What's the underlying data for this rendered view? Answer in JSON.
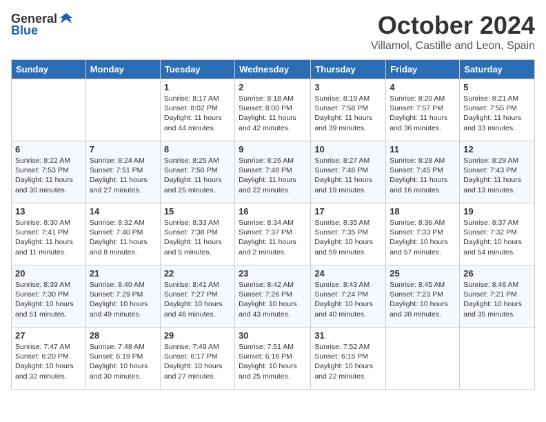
{
  "header": {
    "logo_general": "General",
    "logo_blue": "Blue",
    "month": "October 2024",
    "location": "Villamol, Castille and Leon, Spain"
  },
  "days_of_week": [
    "Sunday",
    "Monday",
    "Tuesday",
    "Wednesday",
    "Thursday",
    "Friday",
    "Saturday"
  ],
  "weeks": [
    [
      {
        "day": null,
        "data": null
      },
      {
        "day": null,
        "data": null
      },
      {
        "day": 1,
        "data": {
          "sunrise": "Sunrise: 8:17 AM",
          "sunset": "Sunset: 8:02 PM",
          "daylight": "Daylight: 11 hours and 44 minutes."
        }
      },
      {
        "day": 2,
        "data": {
          "sunrise": "Sunrise: 8:18 AM",
          "sunset": "Sunset: 8:00 PM",
          "daylight": "Daylight: 11 hours and 42 minutes."
        }
      },
      {
        "day": 3,
        "data": {
          "sunrise": "Sunrise: 8:19 AM",
          "sunset": "Sunset: 7:58 PM",
          "daylight": "Daylight: 11 hours and 39 minutes."
        }
      },
      {
        "day": 4,
        "data": {
          "sunrise": "Sunrise: 8:20 AM",
          "sunset": "Sunset: 7:57 PM",
          "daylight": "Daylight: 11 hours and 36 minutes."
        }
      },
      {
        "day": 5,
        "data": {
          "sunrise": "Sunrise: 8:21 AM",
          "sunset": "Sunset: 7:55 PM",
          "daylight": "Daylight: 11 hours and 33 minutes."
        }
      }
    ],
    [
      {
        "day": 6,
        "data": {
          "sunrise": "Sunrise: 8:22 AM",
          "sunset": "Sunset: 7:53 PM",
          "daylight": "Daylight: 11 hours and 30 minutes."
        }
      },
      {
        "day": 7,
        "data": {
          "sunrise": "Sunrise: 8:24 AM",
          "sunset": "Sunset: 7:51 PM",
          "daylight": "Daylight: 11 hours and 27 minutes."
        }
      },
      {
        "day": 8,
        "data": {
          "sunrise": "Sunrise: 8:25 AM",
          "sunset": "Sunset: 7:50 PM",
          "daylight": "Daylight: 11 hours and 25 minutes."
        }
      },
      {
        "day": 9,
        "data": {
          "sunrise": "Sunrise: 8:26 AM",
          "sunset": "Sunset: 7:48 PM",
          "daylight": "Daylight: 11 hours and 22 minutes."
        }
      },
      {
        "day": 10,
        "data": {
          "sunrise": "Sunrise: 8:27 AM",
          "sunset": "Sunset: 7:46 PM",
          "daylight": "Daylight: 11 hours and 19 minutes."
        }
      },
      {
        "day": 11,
        "data": {
          "sunrise": "Sunrise: 8:28 AM",
          "sunset": "Sunset: 7:45 PM",
          "daylight": "Daylight: 11 hours and 16 minutes."
        }
      },
      {
        "day": 12,
        "data": {
          "sunrise": "Sunrise: 8:29 AM",
          "sunset": "Sunset: 7:43 PM",
          "daylight": "Daylight: 11 hours and 13 minutes."
        }
      }
    ],
    [
      {
        "day": 13,
        "data": {
          "sunrise": "Sunrise: 8:30 AM",
          "sunset": "Sunset: 7:41 PM",
          "daylight": "Daylight: 11 hours and 11 minutes."
        }
      },
      {
        "day": 14,
        "data": {
          "sunrise": "Sunrise: 8:32 AM",
          "sunset": "Sunset: 7:40 PM",
          "daylight": "Daylight: 11 hours and 8 minutes."
        }
      },
      {
        "day": 15,
        "data": {
          "sunrise": "Sunrise: 8:33 AM",
          "sunset": "Sunset: 7:38 PM",
          "daylight": "Daylight: 11 hours and 5 minutes."
        }
      },
      {
        "day": 16,
        "data": {
          "sunrise": "Sunrise: 8:34 AM",
          "sunset": "Sunset: 7:37 PM",
          "daylight": "Daylight: 11 hours and 2 minutes."
        }
      },
      {
        "day": 17,
        "data": {
          "sunrise": "Sunrise: 8:35 AM",
          "sunset": "Sunset: 7:35 PM",
          "daylight": "Daylight: 10 hours and 59 minutes."
        }
      },
      {
        "day": 18,
        "data": {
          "sunrise": "Sunrise: 8:36 AM",
          "sunset": "Sunset: 7:33 PM",
          "daylight": "Daylight: 10 hours and 57 minutes."
        }
      },
      {
        "day": 19,
        "data": {
          "sunrise": "Sunrise: 8:37 AM",
          "sunset": "Sunset: 7:32 PM",
          "daylight": "Daylight: 10 hours and 54 minutes."
        }
      }
    ],
    [
      {
        "day": 20,
        "data": {
          "sunrise": "Sunrise: 8:39 AM",
          "sunset": "Sunset: 7:30 PM",
          "daylight": "Daylight: 10 hours and 51 minutes."
        }
      },
      {
        "day": 21,
        "data": {
          "sunrise": "Sunrise: 8:40 AM",
          "sunset": "Sunset: 7:29 PM",
          "daylight": "Daylight: 10 hours and 49 minutes."
        }
      },
      {
        "day": 22,
        "data": {
          "sunrise": "Sunrise: 8:41 AM",
          "sunset": "Sunset: 7:27 PM",
          "daylight": "Daylight: 10 hours and 46 minutes."
        }
      },
      {
        "day": 23,
        "data": {
          "sunrise": "Sunrise: 8:42 AM",
          "sunset": "Sunset: 7:26 PM",
          "daylight": "Daylight: 10 hours and 43 minutes."
        }
      },
      {
        "day": 24,
        "data": {
          "sunrise": "Sunrise: 8:43 AM",
          "sunset": "Sunset: 7:24 PM",
          "daylight": "Daylight: 10 hours and 40 minutes."
        }
      },
      {
        "day": 25,
        "data": {
          "sunrise": "Sunrise: 8:45 AM",
          "sunset": "Sunset: 7:23 PM",
          "daylight": "Daylight: 10 hours and 38 minutes."
        }
      },
      {
        "day": 26,
        "data": {
          "sunrise": "Sunrise: 8:46 AM",
          "sunset": "Sunset: 7:21 PM",
          "daylight": "Daylight: 10 hours and 35 minutes."
        }
      }
    ],
    [
      {
        "day": 27,
        "data": {
          "sunrise": "Sunrise: 7:47 AM",
          "sunset": "Sunset: 6:20 PM",
          "daylight": "Daylight: 10 hours and 32 minutes."
        }
      },
      {
        "day": 28,
        "data": {
          "sunrise": "Sunrise: 7:48 AM",
          "sunset": "Sunset: 6:19 PM",
          "daylight": "Daylight: 10 hours and 30 minutes."
        }
      },
      {
        "day": 29,
        "data": {
          "sunrise": "Sunrise: 7:49 AM",
          "sunset": "Sunset: 6:17 PM",
          "daylight": "Daylight: 10 hours and 27 minutes."
        }
      },
      {
        "day": 30,
        "data": {
          "sunrise": "Sunrise: 7:51 AM",
          "sunset": "Sunset: 6:16 PM",
          "daylight": "Daylight: 10 hours and 25 minutes."
        }
      },
      {
        "day": 31,
        "data": {
          "sunrise": "Sunrise: 7:52 AM",
          "sunset": "Sunset: 6:15 PM",
          "daylight": "Daylight: 10 hours and 22 minutes."
        }
      },
      {
        "day": null,
        "data": null
      },
      {
        "day": null,
        "data": null
      }
    ]
  ]
}
